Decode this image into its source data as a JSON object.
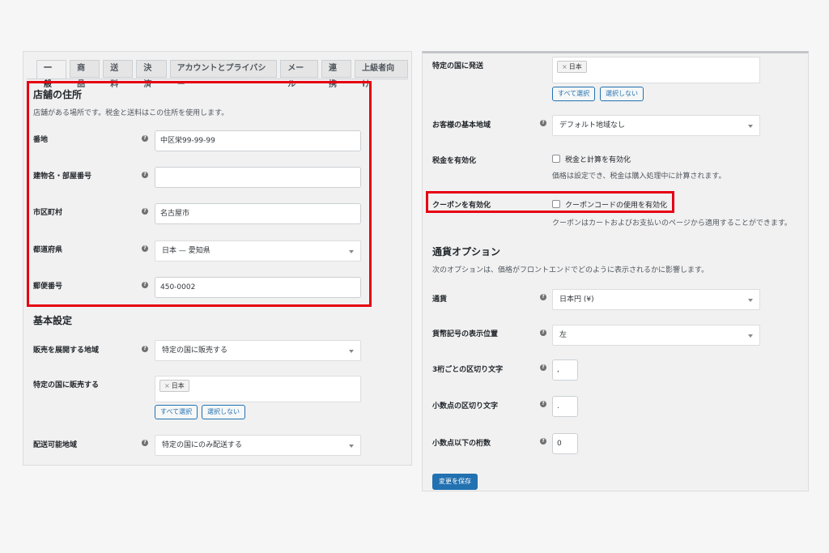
{
  "tabs": [
    "一般",
    "商品",
    "送料",
    "決済",
    "アカウントとプライバシー",
    "メール",
    "連携",
    "上級者向け"
  ],
  "store_address": {
    "title": "店舗の住所",
    "description": "店舗がある場所です。税金と送料はこの住所を使用します。",
    "address1_label": "番地",
    "address1_value": "中区栄99-99-99",
    "address2_label": "建物名・部屋番号",
    "address2_value": "",
    "city_label": "市区町村",
    "city_value": "名古屋市",
    "state_label": "都道府県",
    "state_value": "日本 — 愛知県",
    "postcode_label": "郵便番号",
    "postcode_value": "450-0002"
  },
  "basic_settings": {
    "title": "基本設定",
    "sell_locations_label": "販売を展開する地域",
    "sell_locations_value": "特定の国に販売する",
    "specific_sell_label": "特定の国に販売する",
    "specific_sell_chip": "日本",
    "select_all": "すべて選択",
    "select_none": "選択しない",
    "ship_locations_label": "配送可能地域",
    "ship_locations_value": "特定の国にのみ配送する"
  },
  "right": {
    "specific_ship_label": "特定の国に発送",
    "specific_ship_chip": "日本",
    "select_all": "すべて選択",
    "select_none": "選択しない",
    "default_location_label": "お客様の基本地域",
    "default_location_value": "デフォルト地域なし",
    "enable_taxes_label": "税金を有効化",
    "enable_taxes_checkbox": "税金と計算を有効化",
    "enable_taxes_desc": "価格は設定でき、税金は購入処理中に計算されます。",
    "enable_coupons_label": "クーポンを有効化",
    "enable_coupons_checkbox": "クーポンコードの使用を有効化",
    "enable_coupons_desc": "クーポンはカートおよびお支払いのページから適用することができます。",
    "currency_title": "通貨オプション",
    "currency_desc": "次のオプションは、価格がフロントエンドでどのように表示されるかに影響します。",
    "currency_label": "通貨",
    "currency_value": "日本円 (¥)",
    "currency_pos_label": "貨幣記号の表示位置",
    "currency_pos_value": "左",
    "thousand_sep_label": "3桁ごとの区切り文字",
    "thousand_sep_value": ",",
    "decimal_sep_label": "小数点の区切り文字",
    "decimal_sep_value": ".",
    "num_decimals_label": "小数点以下の桁数",
    "num_decimals_value": "0",
    "save_button": "変更を保存"
  },
  "icons": {
    "help": "help-icon",
    "caret": "caret-down-icon",
    "chip_remove": "close-icon"
  },
  "colors": {
    "highlight": "#e60012",
    "primary": "#2271b1"
  }
}
